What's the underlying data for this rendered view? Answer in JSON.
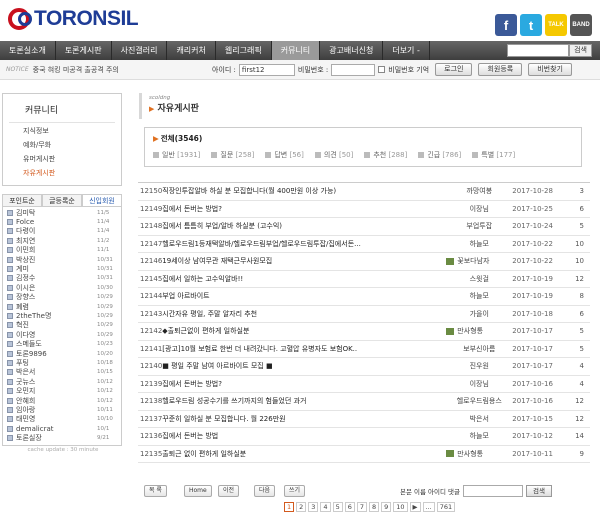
{
  "brand": {
    "name": "TORONSIL"
  },
  "social": [
    {
      "label": "f",
      "color": "#3b5998"
    },
    {
      "label": "t",
      "color": "#2aa9e0"
    },
    {
      "label": "TALK",
      "color": "#f5c800"
    },
    {
      "label": "BAND",
      "color": "#555555"
    }
  ],
  "nav": {
    "items": [
      "토론실소개",
      "토론게시판",
      "사진갤러리",
      "캐리커처",
      "웹리그래픽",
      "커뮤니티",
      "광고배너신청",
      "더보기 -"
    ],
    "active": 5,
    "search_button": "검색"
  },
  "subbar": {
    "notice_label": "NOTICE",
    "notice_text": "중국 혀킹 미공격 출공격 주의",
    "id_label": "아이디 :",
    "id_value": "first12",
    "pw_label": "비밀번호 :",
    "remember_label": "비밀번호 기억",
    "login_btn": "로그인",
    "join_btn": "회원등록",
    "find_btn": "비번찾기"
  },
  "sidebar": {
    "title": "커뮤니티",
    "menu": [
      "지식정보",
      "예화/무화",
      "유머게시판",
      "자유게시판"
    ],
    "active_menu": 3,
    "tabs": [
      "포인트순",
      "글등록순",
      "신입회원"
    ],
    "active_tab": 2,
    "users": [
      [
        "김미탁",
        "11/5"
      ],
      [
        "Folce",
        "11/4"
      ],
      [
        "다령이",
        "11/4"
      ],
      [
        "최지연",
        "11/2"
      ],
      [
        "이민희",
        "11/1"
      ],
      [
        "박상진",
        "10/31"
      ],
      [
        "계미",
        "10/31"
      ],
      [
        "김정수",
        "10/31"
      ],
      [
        "이시은",
        "10/30"
      ],
      [
        "장향스",
        "10/29"
      ],
      [
        "폐렴",
        "10/29"
      ],
      [
        "2theThe명",
        "10/29"
      ],
      [
        "혁진",
        "10/29"
      ],
      [
        "이다영",
        "10/29"
      ],
      [
        "스메들도",
        "10/23"
      ],
      [
        "토론9896",
        "10/20"
      ],
      [
        "푸팅",
        "10/18"
      ],
      [
        "박은서",
        "10/15"
      ],
      [
        "굿뉴스",
        "10/12"
      ],
      [
        "오민지",
        "10/12"
      ],
      [
        "안혜희",
        "10/12"
      ],
      [
        "임아랑",
        "10/11"
      ],
      [
        "태민영",
        "10/10"
      ],
      [
        "demalicrat",
        "10/1"
      ],
      [
        "토론실장",
        "9/21"
      ]
    ],
    "cache": "cache update : 30 minute"
  },
  "main": {
    "title_en": "scoldng",
    "title_ko": "자유게시판",
    "all_label": "전체(3546)",
    "cats": [
      [
        "일반",
        "1931"
      ],
      [
        "질문",
        "258"
      ],
      [
        "답변",
        "56"
      ],
      [
        "의견",
        "50"
      ],
      [
        "추천",
        "288"
      ],
      [
        "긴급",
        "786"
      ],
      [
        "특별",
        "177"
      ]
    ],
    "rows": [
      {
        "no": "12150",
        "title": "직장인투잡알바 하실 분 모집합니다(월 400만원 이상 가능)",
        "author": "까망여봉",
        "date": "2017-10-28",
        "views": "3",
        "photo": false
      },
      {
        "no": "12149",
        "title": "집에서 돈버는 방법?",
        "author": "이장님",
        "date": "2017-10-25",
        "views": "6",
        "photo": false
      },
      {
        "no": "12148",
        "title": "집에서 틈틈히 부업/알바 하실분 (고수익)",
        "author": "부업투잡",
        "date": "2017-10-24",
        "views": "5",
        "photo": false
      },
      {
        "no": "12147",
        "title": "헬로우드림1등재택알바/헬로우드림부업/헬로우드림투잡/집에서돈...",
        "author": "하늘모",
        "date": "2017-10-22",
        "views": "10",
        "photo": false
      },
      {
        "no": "12146",
        "title": "19세이상 남여무관 재택근무사원모집",
        "author": "꽃보다남자",
        "date": "2017-10-22",
        "views": "10",
        "photo": true
      },
      {
        "no": "12145",
        "title": "집에서 일하는 고수익알바!!",
        "author": "스윗걸",
        "date": "2017-10-19",
        "views": "12",
        "photo": false
      },
      {
        "no": "12144",
        "title": "부업 아르바이트",
        "author": "하늘모",
        "date": "2017-10-19",
        "views": "8",
        "photo": false
      },
      {
        "no": "12143",
        "title": "시간자유 평일, 주말 알자리 추천",
        "author": "가을이",
        "date": "2017-10-18",
        "views": "6",
        "photo": false
      },
      {
        "no": "12142",
        "title": "◆출퇴근없이 편하게 일하실분",
        "author": "만사형통",
        "date": "2017-10-17",
        "views": "5",
        "photo": true
      },
      {
        "no": "12141",
        "title": "[광고]10월 보험료 한번 더 내려갔니다. 고혈압 유병자도 보험OK..",
        "author": "보부신아름",
        "date": "2017-10-17",
        "views": "5",
        "photo": false
      },
      {
        "no": "12140",
        "title": "■ 평일 주말 남여 아르바이트 모집 ■",
        "author": "진우원",
        "date": "2017-10-17",
        "views": "4",
        "photo": false
      },
      {
        "no": "12139",
        "title": "집에서 돈버는 방법?",
        "author": "이장님",
        "date": "2017-10-16",
        "views": "4",
        "photo": false
      },
      {
        "no": "12138",
        "title": "헬로우드림 성공수기를 쓰기까지의 험들었던 과거",
        "author": "헬로우드림용스",
        "date": "2017-10-16",
        "views": "12",
        "photo": false
      },
      {
        "no": "12137",
        "title": "꾸준히 일하실 분 모집합니다. 월 226만원",
        "author": "박은서",
        "date": "2017-10-15",
        "views": "12",
        "photo": false
      },
      {
        "no": "12136",
        "title": "집에서 돈버는 방법",
        "author": "하늘모",
        "date": "2017-10-12",
        "views": "14",
        "photo": false
      },
      {
        "no": "12135",
        "title": "출퇴근 없이 편하게 일하실분",
        "author": "만사형통",
        "date": "2017-10-11",
        "views": "9",
        "photo": true
      }
    ]
  },
  "footer": {
    "buttons": [
      "목 록",
      "Home",
      "이전",
      "다음",
      "쓰기"
    ],
    "search_opts": "본문 이름 아이디 댓글",
    "search_btn": "검색",
    "pages": [
      "1",
      "2",
      "3",
      "4",
      "5",
      "6",
      "7",
      "8",
      "9",
      "10",
      "▶",
      "...",
      "761"
    ],
    "active_page": 0
  }
}
